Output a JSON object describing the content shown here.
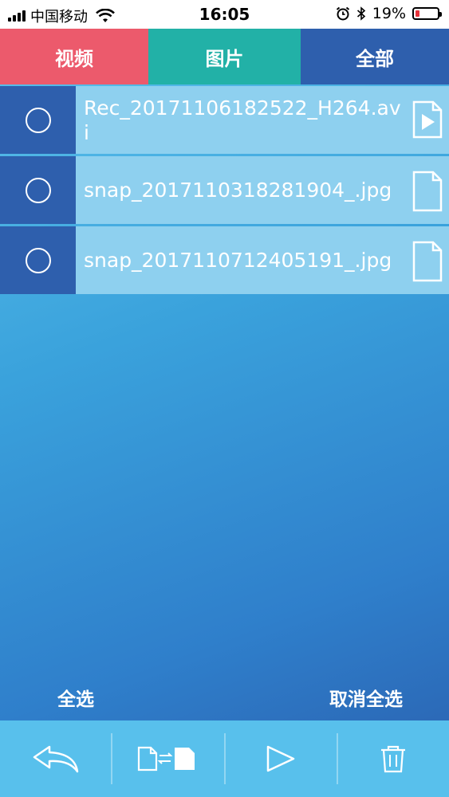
{
  "status_bar": {
    "carrier": "中国移动",
    "time": "16:05",
    "battery": "19%",
    "battery_color": "#e8323a"
  },
  "tabs": [
    {
      "label": "视频",
      "color": "#ec5a6c"
    },
    {
      "label": "图片",
      "color": "#22b1a7"
    },
    {
      "label": "全部",
      "color": "#2e5fad"
    }
  ],
  "files": [
    {
      "name": "Rec_20171106182522_H264.avi",
      "icon": "video-file-icon"
    },
    {
      "name": "snap_20171103182819​04_.jpg",
      "icon": "image-file-icon"
    },
    {
      "name": "snap_2017110712405191_.jpg",
      "icon": "image-file-icon"
    }
  ],
  "select_bar": {
    "select_all": "全选",
    "deselect_all": "取消全选"
  },
  "toolbar": {
    "icons": [
      "back-icon",
      "transfer-files-icon",
      "play-icon",
      "trash-icon"
    ]
  }
}
